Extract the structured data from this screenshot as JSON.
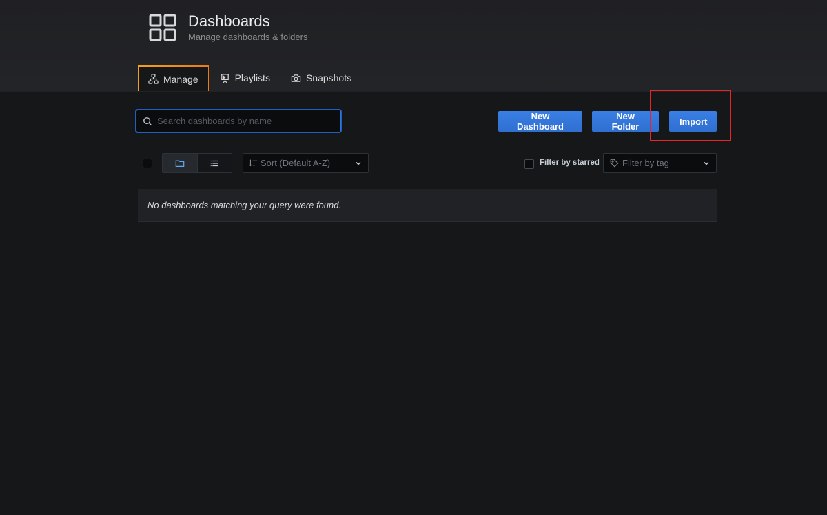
{
  "header": {
    "title": "Dashboards",
    "subtitle": "Manage dashboards & folders",
    "icon": "apps-grid-icon"
  },
  "tabs": [
    {
      "label": "Manage",
      "icon": "sitemap-icon",
      "active": true
    },
    {
      "label": "Playlists",
      "icon": "presentation-icon",
      "active": false
    },
    {
      "label": "Snapshots",
      "icon": "camera-icon",
      "active": false
    }
  ],
  "search": {
    "placeholder": "Search dashboards by name",
    "value": ""
  },
  "actions": {
    "new_dashboard": "New Dashboard",
    "new_folder": "New Folder",
    "import": "Import"
  },
  "toolbar": {
    "sort_placeholder": "Sort (Default A-Z)",
    "filter_starred_label": "Filter by starred",
    "filter_tag_placeholder": "Filter by tag"
  },
  "results": {
    "empty_message": "No dashboards matching your query were found."
  },
  "colors": {
    "primary": "#3274d9",
    "background": "#161719",
    "header_background": "#222326",
    "tab_accent": "#f0a21b",
    "highlight": "#e8262a"
  }
}
